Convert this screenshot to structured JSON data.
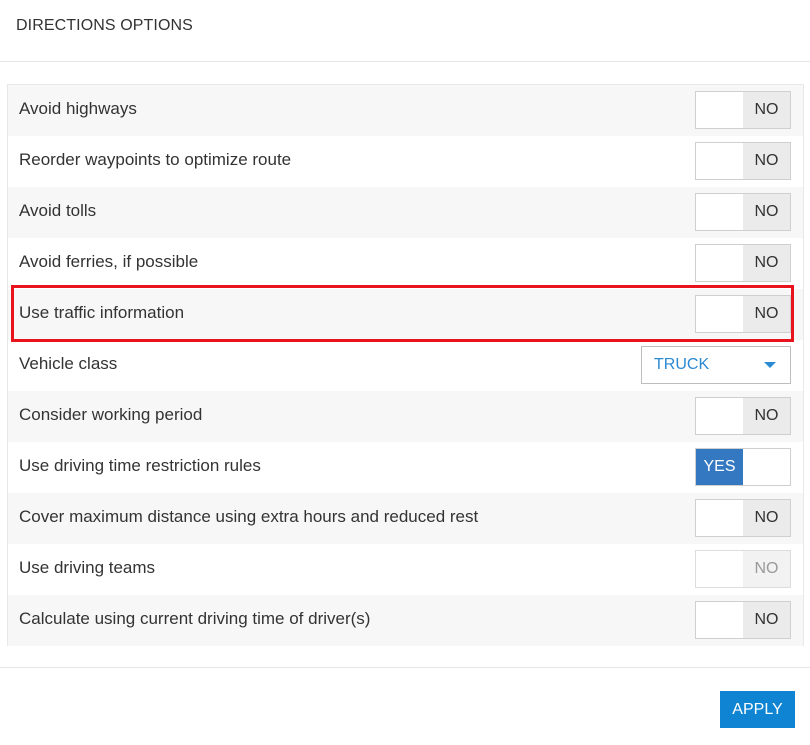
{
  "dialog": {
    "title": "DIRECTIONS OPTIONS"
  },
  "options": [
    {
      "label": "Avoid highways",
      "control": "toggle",
      "state": "NO"
    },
    {
      "label": "Reorder waypoints to optimize route",
      "control": "toggle",
      "state": "NO"
    },
    {
      "label": "Avoid tolls",
      "control": "toggle",
      "state": "NO"
    },
    {
      "label": "Avoid ferries, if possible",
      "control": "toggle",
      "state": "NO"
    },
    {
      "label": "Use traffic information",
      "control": "toggle",
      "state": "NO",
      "highlighted": true
    },
    {
      "label": "Vehicle class",
      "control": "select",
      "value": "TRUCK"
    },
    {
      "label": "Consider working period",
      "control": "toggle",
      "state": "NO"
    },
    {
      "label": "Use driving time restriction rules",
      "control": "toggle",
      "state": "YES"
    },
    {
      "label": "Cover maximum distance using extra hours and reduced rest",
      "control": "toggle",
      "state": "NO"
    },
    {
      "label": "Use driving teams",
      "control": "toggle",
      "state": "NO",
      "disabled": true
    },
    {
      "label": "Calculate using current driving time of driver(s)",
      "control": "toggle",
      "state": "NO"
    }
  ],
  "footer": {
    "apply_label": "APPLY"
  },
  "colors": {
    "accent": "#0e84d2",
    "toggle_on": "#3378c1",
    "select_text": "#2a8ad4",
    "highlight": "#e8141d"
  }
}
